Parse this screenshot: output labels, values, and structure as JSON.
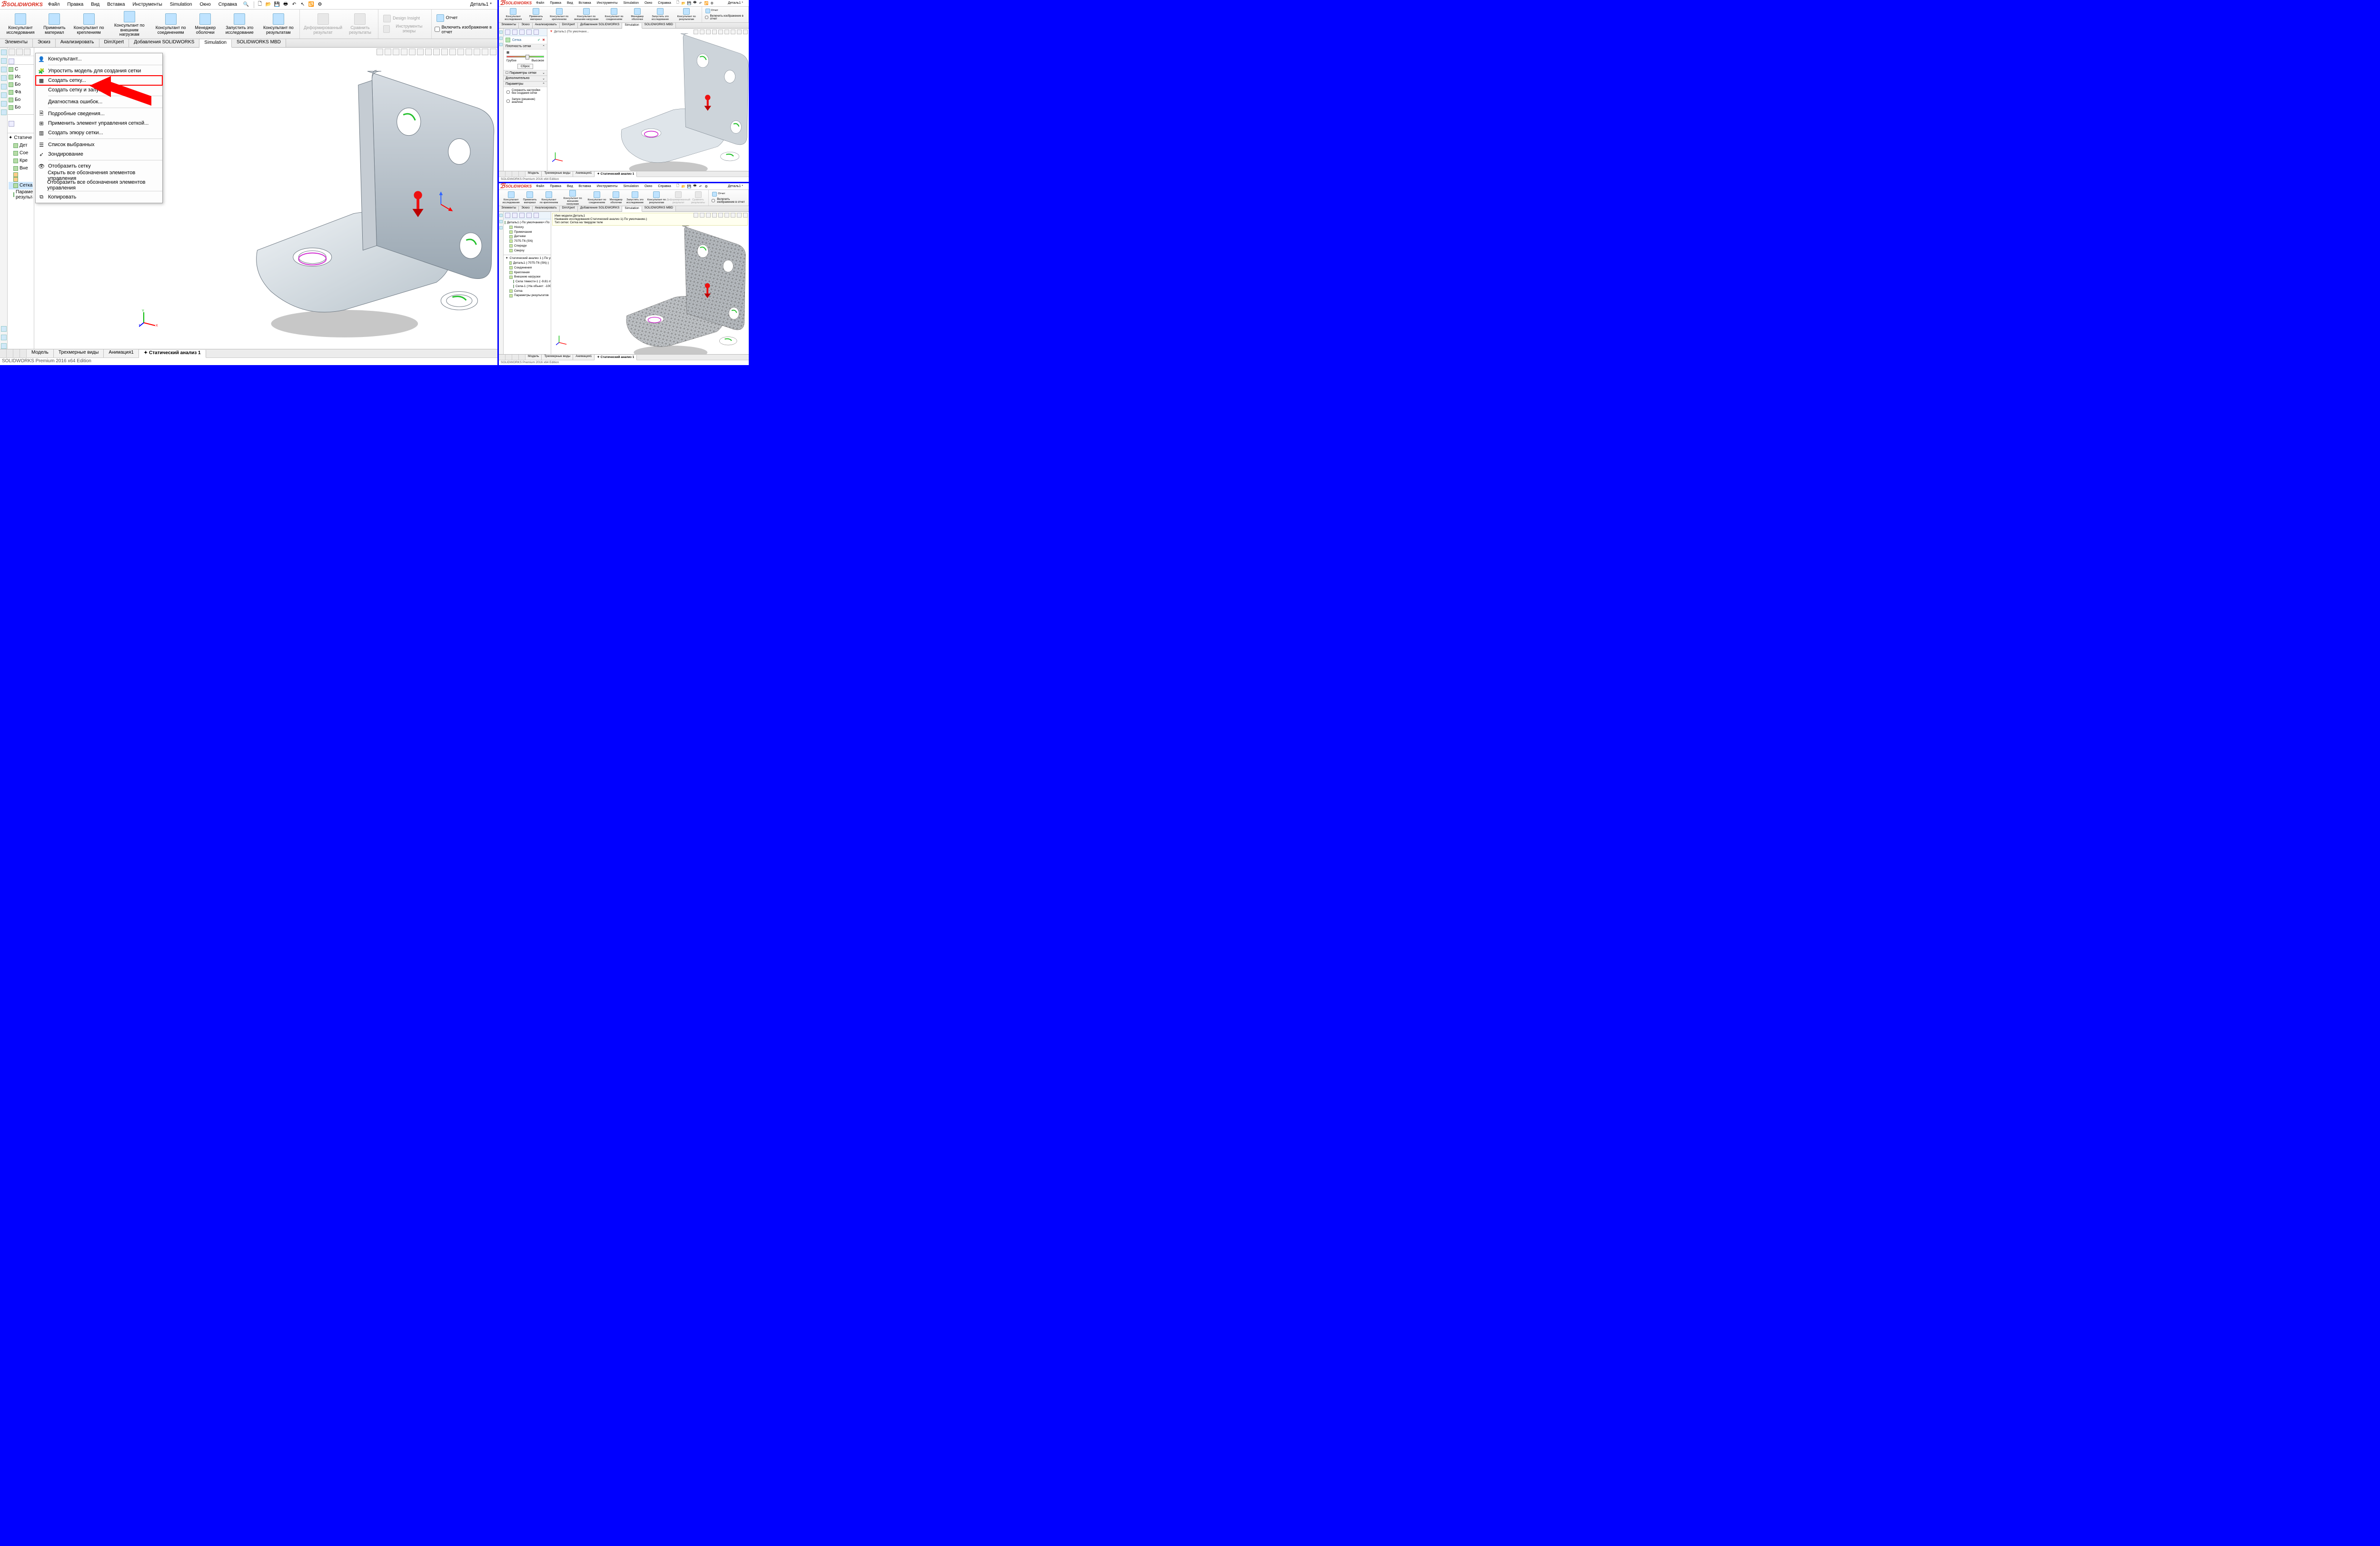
{
  "app": {
    "logo": "SOLIDWORKS",
    "doc": "Деталь1 *"
  },
  "menu": [
    "Файл",
    "Правка",
    "Вид",
    "Вставка",
    "Инструменты",
    "Simulation",
    "Окно",
    "Справка"
  ],
  "ribbon_main": [
    {
      "label": "Консультант\nисследования"
    },
    {
      "label": "Применить\nматериал"
    },
    {
      "label": "Консультант по\nкреплениям"
    },
    {
      "label": "Консультант по\nвнешним нагрузкам"
    },
    {
      "label": "Консультант по\nсоединениям"
    },
    {
      "label": "Менеджер\nоболочки"
    },
    {
      "label": "Запустить это\nисследование"
    },
    {
      "label": "Консультант по\nрезультатам"
    },
    {
      "label": "Деформированный\nрезультат",
      "disabled": true
    },
    {
      "label": "Сравнить\nрезультаты",
      "disabled": true
    },
    {
      "label": "Design Insight",
      "disabled": true
    },
    {
      "label": "Инструменты эпюры",
      "disabled": true
    },
    {
      "label": "Отчет"
    }
  ],
  "ribbon_check": "Включить изображение в отчет",
  "tabs": [
    "Элементы",
    "Эскиз",
    "Анализировать",
    "DimXpert",
    "Добавления SOLIDWORKS",
    "Simulation",
    "SOLIDWORKS MBD"
  ],
  "tabs_active": "Simulation",
  "fm_nodes": [
    "С",
    "Ис",
    "Бо",
    "Фа",
    "Бо",
    "Бо"
  ],
  "sim_tree_main": [
    "Статиче",
    "Дет",
    "Сое",
    "Кре",
    "Вне"
  ],
  "sim_tree_mesh": "Сетка",
  "sim_tree_results": "Параметры результатов",
  "ctx": {
    "advisor": "Консультант...",
    "simplify": "Упростить модель для создания сетки",
    "create_mesh": "Создать сетку...",
    "create_run": "Создать сетку и запустить",
    "diag": "Диагностика ошибок...",
    "details": "Подробные сведения...",
    "apply_ctrl": "Применить элемент управления сеткой...",
    "create_plot": "Создать эпюру сетки...",
    "sel_list": "Список выбранных",
    "probe": "Зондирование",
    "show_mesh": "Отобразить сетку",
    "hide_all": "Скрыть все обозначения элементов управления",
    "show_all": "Отобразить все обозначения элементов управления",
    "copy": "Копировать"
  },
  "bottom_tabs": [
    "Модель",
    "Трехмерные виды",
    "Анимация1",
    "Статический анализ 1"
  ],
  "bottom_active": "Статический анализ 1",
  "status": "SOLIDWORKS Premium 2016 x64 Edition",
  "pm": {
    "title": "Сетка",
    "density_hdr": "Плотность сетки",
    "coarse": "Грубое",
    "fine": "Высокое",
    "reset": "Сброс",
    "params_hdr": "Параметры сетки",
    "advanced_hdr": "Дополнительно",
    "options_hdr": "Параметры",
    "opt1": "Сохранить настройки без создания сетки",
    "opt2": "Запуск (решение) анализа"
  },
  "br_msg": {
    "l1": "Имя модели:Деталь1",
    "l2": "Название исследования:Статический анализ 1(-По умолчанию-)",
    "l3": "Тип сетки: Сетка на твердом теле"
  },
  "fm_br": [
    "Деталь1 (-По умолчанию<-Пo умол",
    "History",
    "Примечания",
    "Датчики",
    "7075-T6 (SN)",
    "Спереди",
    "Сверху"
  ],
  "study_br": {
    "root": "Статический анализ 1 (-По умолчан",
    "part": "Деталь1 (-7075-T6 (SN)-)",
    "conn": "Соединения",
    "fix": "Крепления",
    "loads": "Внешние нагрузки",
    "grav": "Сила тяжести-1 (:-9.81 m/s^2:)",
    "force": "Сила-1 (:На объект: -1000 N:)",
    "mesh": "Сетка",
    "res": "Параметры результатов"
  },
  "fm_bc": "Деталь1 (По умолчани..."
}
